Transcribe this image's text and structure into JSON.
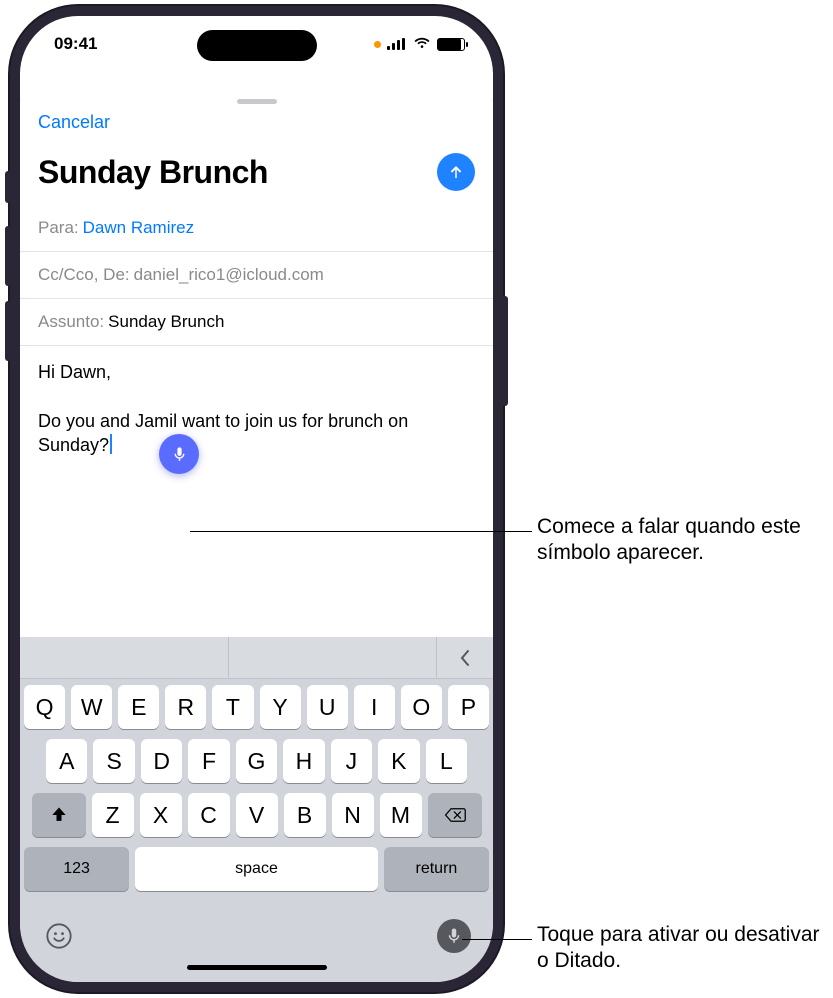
{
  "status": {
    "time": "09:41"
  },
  "sheet": {
    "cancel": "Cancelar",
    "title": "Sunday Brunch",
    "to_label": "Para:",
    "to_value": "Dawn Ramirez",
    "cc_label": "Cc/Cco, De:",
    "cc_value": "daniel_rico1@icloud.com",
    "subject_label": "Assunto:",
    "subject_value": "Sunday Brunch",
    "body_greeting": "Hi Dawn,",
    "body_text": "Do you and Jamil want to join us for brunch on Sunday?"
  },
  "keyboard": {
    "row1": [
      "Q",
      "W",
      "E",
      "R",
      "T",
      "Y",
      "U",
      "I",
      "O",
      "P"
    ],
    "row2": [
      "A",
      "S",
      "D",
      "F",
      "G",
      "H",
      "J",
      "K",
      "L"
    ],
    "row3": [
      "Z",
      "X",
      "C",
      "V",
      "B",
      "N",
      "M"
    ],
    "num": "123",
    "space": "space",
    "return": "return"
  },
  "callouts": {
    "c1": "Comece a falar quando este símbolo aparecer.",
    "c2": "Toque para ativar ou desativar o Ditado."
  }
}
